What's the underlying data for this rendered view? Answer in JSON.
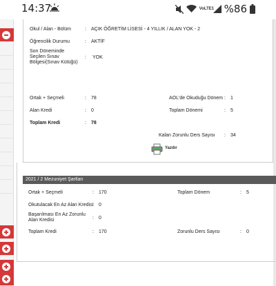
{
  "status_bar": {
    "time": "14:37",
    "network_label": "VoLTE1",
    "battery_percent": "%86",
    "icons": [
      "weather-icon",
      "mute-icon",
      "wifi-icon",
      "signal-icon",
      "battery-icon"
    ]
  },
  "student_info": {
    "program_label": "Okul / Alan - Bölüm",
    "program_sep": ":",
    "program_value": "AÇIK ÖĞRETİM LİSESİ - 4 YILLIK / ALAN YOK - 2",
    "status_label": "Öğrencilik Durumu",
    "status_sep": ":",
    "status_value": "AKTİF",
    "exam_region_label": "Son Döneminde Seçilen Sınav Bölgesi(Sınav Kütüğü)",
    "exam_region_sep": ":",
    "exam_region_value": "YOK"
  },
  "credits": {
    "common_elective_label": "Ortak + Seçmeli",
    "common_elective_sep": ":",
    "common_elective_value": "78",
    "field_credit_label": "Alan Kredi",
    "field_credit_sep": ":",
    "field_credit_value": "0",
    "total_credit_label": "Toplam Kredi",
    "total_credit_sep": ":",
    "total_credit_value": "78",
    "aol_terms_label": "AOL'de Okuduğu Dönem",
    "aol_terms_sep": ":",
    "aol_terms_value": "1",
    "total_terms_label": "Toplam Dönemi",
    "total_terms_sep": ":",
    "total_terms_value": "5",
    "remaining_courses_label": "Kalan Zorunlu Ders Sayısı",
    "remaining_courses_sep": ":",
    "remaining_courses_value": "34"
  },
  "print": {
    "label": "Yazdır"
  },
  "graduation": {
    "title": "2021 / 2 Mezuniyet Şartları",
    "common_elective_label": "Ortak + Seçmeli",
    "common_elective_sep": ":",
    "common_elective_value": "170",
    "total_term_label": "Toplam Dönem",
    "total_term_sep": ":",
    "total_term_value": "5",
    "min_field_credit_label": "Okutulacak En Az Alan Kredisi",
    "min_field_credit_sep": ":",
    "min_field_credit_value": "0",
    "min_pass_field_credit_label": "Başarılması En Az Zorunlu Alan Kredisi",
    "min_pass_field_credit_sep": ":",
    "min_pass_field_credit_value": "0",
    "total_credit_label": "Toplam Kredi",
    "total_credit_sep": ":",
    "total_credit_value": "170",
    "required_courses_label": "Zorunlu Ders Sayısı",
    "required_courses_sep": ":",
    "required_courses_value": "0"
  },
  "colors": {
    "sidebar_accent": "#d53838",
    "section_header_bg": "#5a5a5a"
  }
}
